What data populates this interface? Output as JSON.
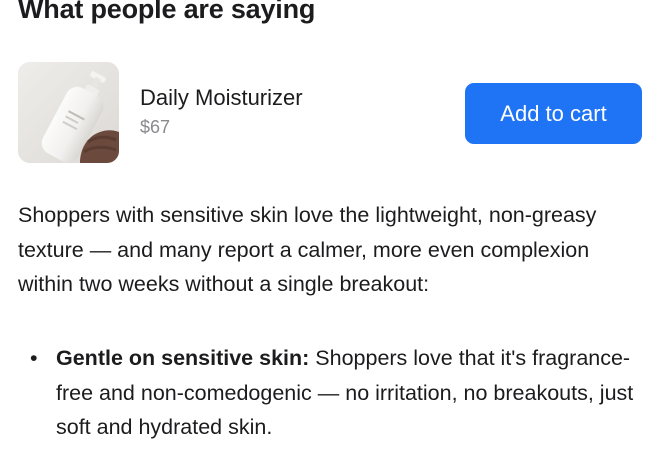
{
  "section": {
    "heading": "What people are saying"
  },
  "product": {
    "name": "Daily Moisturizer",
    "price": "$67",
    "image_icon": "moisturizer-bottle",
    "add_to_cart_label": "Add to cart",
    "button_color": "#1f73f5"
  },
  "summary": {
    "text": "Shoppers with sensitive skin love the lightweight, non-greasy texture — and many report a calmer, more even complexion within two weeks without a single breakout:"
  },
  "highlights": [
    {
      "title": "Gentle on sensitive skin:",
      "text": " Shoppers love that it's fragrance-free and non-comedogenic — no irritation, no breakouts, just soft and hydrated skin."
    }
  ]
}
